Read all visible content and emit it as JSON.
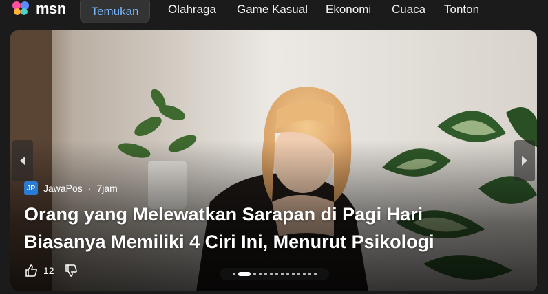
{
  "brand": {
    "name": "msn"
  },
  "nav": {
    "active": "Temukan",
    "items": [
      "Olahraga",
      "Game Kasual",
      "Ekonomi",
      "Cuaca",
      "Tonton"
    ]
  },
  "hero": {
    "source": {
      "logo_text": "JP",
      "name": "JawaPos",
      "separator": "·",
      "time": "7jam"
    },
    "headline_line1": "Orang yang Melewatkan Sarapan di Pagi Hari",
    "headline_line2": "Biasanya Memiliki 4 Ciri Ini, Menurut Psikologi",
    "likes": "12",
    "slide_count": 14,
    "active_slide": 1
  },
  "colors": {
    "accent": "#7ab7ff",
    "background": "#1b1b1b"
  },
  "icons": [
    "msn-butterfly-icon",
    "chevron-left-icon",
    "chevron-right-icon",
    "thumbs-up-icon",
    "thumbs-down-icon"
  ]
}
